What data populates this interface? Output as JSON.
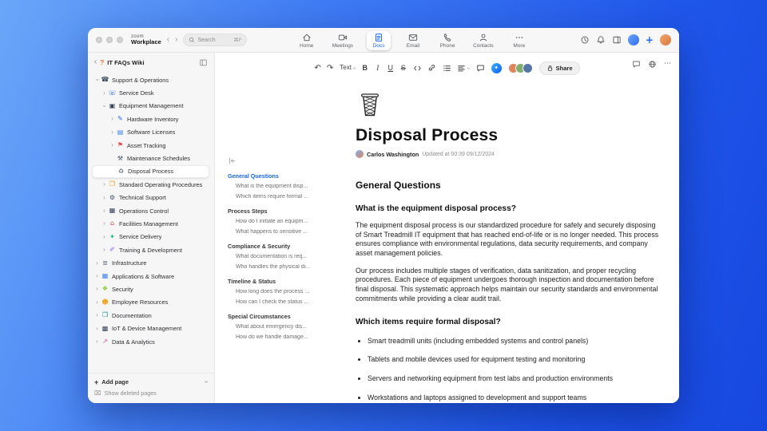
{
  "colors": {
    "accent": "#1a66ff",
    "zoom_blue": "#0b5cff",
    "wallpaper_start": "#6aa6f8",
    "wallpaper_end": "#1747df"
  },
  "glyphs": {
    "back": "‹",
    "forward": "›",
    "chevron": "›",
    "undo": "↶",
    "redo": "↷",
    "plus": "+",
    "more_h": "⋯",
    "ai": "✦",
    "bullet": "•"
  },
  "icons": {
    "wiki": {
      "glyph": "?",
      "color": "#ff6a2a"
    },
    "phone": {
      "glyph": "☎",
      "color": "#334155"
    },
    "headset": {
      "glyph": "☏",
      "color": "#2563eb"
    },
    "monitor": {
      "glyph": "▣",
      "color": "#334155"
    },
    "tool": {
      "glyph": "✎",
      "color": "#2563eb"
    },
    "license": {
      "glyph": "▤",
      "color": "#3b82f6"
    },
    "pin": {
      "glyph": "⚑",
      "color": "#ef4444"
    },
    "wrench": {
      "glyph": "⚒",
      "color": "#475569"
    },
    "trash": {
      "glyph": "♻",
      "color": "#6b7280"
    },
    "book": {
      "glyph": "❐",
      "color": "#f59e0b"
    },
    "gear": {
      "glyph": "⚙",
      "color": "#475569"
    },
    "building": {
      "glyph": "▦",
      "color": "#334155"
    },
    "facility": {
      "glyph": "⌂",
      "color": "#ef4444"
    },
    "service": {
      "glyph": "✦",
      "color": "#10b981"
    },
    "graduation": {
      "glyph": "✐",
      "color": "#8b5cf6"
    },
    "server": {
      "glyph": "≣",
      "color": "#64748b"
    },
    "apps": {
      "glyph": "▦",
      "color": "#3b82f6"
    },
    "shield": {
      "glyph": "❖",
      "color": "#84cc16"
    },
    "people": {
      "glyph": "☻",
      "color": "#f59e0b"
    },
    "docs": {
      "glyph": "❒",
      "color": "#0d9488"
    },
    "chip": {
      "glyph": "▩",
      "color": "#334155"
    },
    "chart": {
      "glyph": "↗",
      "color": "#ec4899"
    },
    "deleted": {
      "glyph": "⌧",
      "color": "#8e8e92"
    }
  },
  "titlebar": {
    "brand_line1": "zoom",
    "brand_line2": "Workplace",
    "search_placeholder": "Search",
    "search_shortcut": "⌘F",
    "tabs": [
      {
        "label": "Home"
      },
      {
        "label": "Meetings"
      },
      {
        "label": "Docs",
        "active": true
      },
      {
        "label": "Email"
      },
      {
        "label": "Phone"
      },
      {
        "label": "Contacts"
      },
      {
        "label": "More"
      }
    ]
  },
  "sidebar": {
    "title": "IT FAQs Wiki",
    "add_page": "Add page",
    "show_deleted": "Show deleted pages",
    "tree": [
      {
        "label": "Support & Operations",
        "level": 0,
        "chevron": "expanded",
        "icon": "phone"
      },
      {
        "label": "Service Desk",
        "level": 1,
        "chevron": "collapsed",
        "icon": "headset"
      },
      {
        "label": "Equipment Management",
        "level": 1,
        "chevron": "expanded",
        "icon": "monitor"
      },
      {
        "label": "Hardware Inventory",
        "level": 2,
        "chevron": "collapsed",
        "icon": "tool"
      },
      {
        "label": "Software Licenses",
        "level": 2,
        "chevron": "collapsed",
        "icon": "license"
      },
      {
        "label": "Asset Tracking",
        "level": 2,
        "chevron": "collapsed",
        "icon": "pin"
      },
      {
        "label": "Maintenance Schedules",
        "level": 2,
        "chevron": "none",
        "icon": "wrench"
      },
      {
        "label": "Disposal Process",
        "level": 2,
        "chevron": "none",
        "icon": "trash",
        "selected": true
      },
      {
        "label": "Standard Operating Procedures",
        "level": 1,
        "chevron": "collapsed",
        "icon": "book"
      },
      {
        "label": "Technical Support",
        "level": 1,
        "chevron": "collapsed",
        "icon": "gear"
      },
      {
        "label": "Operations Control",
        "level": 1,
        "chevron": "collapsed",
        "icon": "building"
      },
      {
        "label": "Facilities Management",
        "level": 1,
        "chevron": "collapsed",
        "icon": "facility"
      },
      {
        "label": "Service Delivery",
        "level": 1,
        "chevron": "collapsed",
        "icon": "service"
      },
      {
        "label": "Training & Development",
        "level": 1,
        "chevron": "collapsed",
        "icon": "graduation"
      },
      {
        "label": "Infrastructure",
        "level": 0,
        "chevron": "collapsed",
        "icon": "server"
      },
      {
        "label": "Applications & Software",
        "level": 0,
        "chevron": "collapsed",
        "icon": "apps"
      },
      {
        "label": "Security",
        "level": 0,
        "chevron": "collapsed",
        "icon": "shield"
      },
      {
        "label": "Employee Resources",
        "level": 0,
        "chevron": "collapsed",
        "icon": "people"
      },
      {
        "label": "Documentation",
        "level": 0,
        "chevron": "collapsed",
        "icon": "docs"
      },
      {
        "label": "IoT & Device Management",
        "level": 0,
        "chevron": "collapsed",
        "icon": "chip"
      },
      {
        "label": "Data & Analytics",
        "level": 0,
        "chevron": "collapsed",
        "icon": "chart"
      }
    ]
  },
  "toolbar": {
    "text_style": "Text",
    "bold": "B",
    "italic": "I",
    "underline": "U",
    "strike": "S",
    "share_label": "Share",
    "avatars": [
      {
        "color": "#e2845a"
      },
      {
        "color": "#7fae6d"
      },
      {
        "color": "#5577a8"
      }
    ]
  },
  "outline": {
    "entries": [
      {
        "label": "General Questions",
        "kind": "section",
        "active": true
      },
      {
        "label": "What is the equipment disp...",
        "kind": "item"
      },
      {
        "label": "Which items require formal ...",
        "kind": "item"
      },
      {
        "label": "Process Steps",
        "kind": "section"
      },
      {
        "label": "How do I initiate an equipm...",
        "kind": "item"
      },
      {
        "label": "What happens to sensitive ...",
        "kind": "item"
      },
      {
        "label": "Compliance & Security",
        "kind": "section"
      },
      {
        "label": "What documentation is req...",
        "kind": "item"
      },
      {
        "label": "Who handles the physical di...",
        "kind": "item"
      },
      {
        "label": "Timeline & Status",
        "kind": "section"
      },
      {
        "label": "How long does the process ...",
        "kind": "item"
      },
      {
        "label": "How can I check the status ...",
        "kind": "item"
      },
      {
        "label": "Special Circumstances",
        "kind": "section"
      },
      {
        "label": "What about emergency dis...",
        "kind": "item"
      },
      {
        "label": "How do we handle damage...",
        "kind": "item"
      }
    ]
  },
  "document": {
    "title": "Disposal Process",
    "author": "Carlos Washington",
    "updated": "Updated at 00:39 09/12/2024",
    "h2": "General Questions",
    "q1": "What is the equipment disposal process?",
    "p1": "The equipment disposal process is our standardized procedure for safely and securely disposing of Smart Treadmill IT equipment that has reached end-of-life or is no longer needed. This process ensures compliance with environmental regulations, data security requirements, and company asset management policies.",
    "p2": "Our process includes multiple stages of verification, data sanitization, and proper recycling procedures. Each piece of equipment undergoes thorough inspection and documentation before final disposal. This systematic approach helps maintain our security standards and environmental commitments while providing a clear audit trail.",
    "q2": "Which items require formal disposal?",
    "bullets": [
      {
        "text": "Smart treadmill units (including embedded systems and control panels)"
      },
      {
        "text": "Tablets and mobile devices used for equipment testing and monitoring"
      },
      {
        "text": "Servers and networking equipment from test labs and production environments"
      },
      {
        "text": "Workstations and laptops assigned to development and support teams"
      }
    ]
  }
}
